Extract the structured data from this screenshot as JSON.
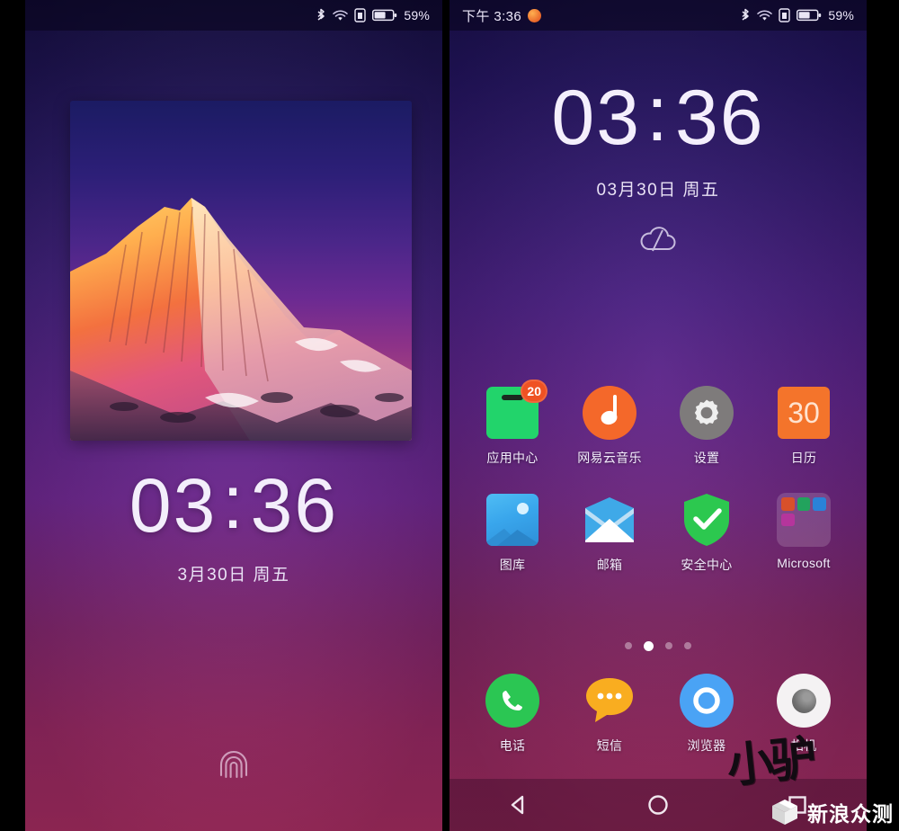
{
  "screens": {
    "lock": {
      "name": "lock-screen",
      "statusbar": {
        "time": "",
        "battery_percent": "59%",
        "icons": [
          "bluetooth-icon",
          "wifi-icon",
          "sim-icon",
          "battery-icon"
        ]
      },
      "clock": {
        "hours": "03",
        "separator": ":",
        "minutes": "36",
        "date": "3月30日  周五"
      },
      "unlock_hint_icon": "fingerprint-icon"
    },
    "home": {
      "name": "home-screen",
      "statusbar": {
        "time": "下午 3:36",
        "notification_icon": "orange-dot-icon",
        "battery_percent": "59%",
        "icons": [
          "bluetooth-icon",
          "wifi-icon",
          "sim-icon",
          "battery-icon"
        ]
      },
      "widget": {
        "hours": "03",
        "separator": ":",
        "minutes": "36",
        "date": "03月30日   周五",
        "weather_icon": "cloud-icon"
      },
      "apps": [
        {
          "label": "应用中心",
          "icon": "app-center-icon",
          "badge": "20",
          "color": "#22d46b"
        },
        {
          "label": "网易云音乐",
          "icon": "netease-music-icon",
          "badge": "",
          "color": "#f4682a"
        },
        {
          "label": "设置",
          "icon": "settings-gear-icon",
          "badge": "",
          "color": "#7e7b7b"
        },
        {
          "label": "日历",
          "icon": "calendar-icon",
          "badge": "",
          "color": "#f4742b",
          "day": "30"
        },
        {
          "label": "图库",
          "icon": "gallery-icon",
          "badge": "",
          "color": "#39a6ec"
        },
        {
          "label": "邮箱",
          "icon": "mail-icon",
          "badge": "",
          "color": "#2a9fe0"
        },
        {
          "label": "安全中心",
          "icon": "security-shield-icon",
          "badge": "",
          "color": "#2bc653"
        },
        {
          "label": "Microsoft",
          "icon": "folder-icon",
          "badge": "",
          "color": "#ffffff29"
        }
      ],
      "folder_mini_icons": [
        "powerpoint-icon",
        "excel-icon",
        "skype-icon",
        "onenote-icon"
      ],
      "page_indicator": {
        "total": 4,
        "active_index": 1
      },
      "dock": [
        {
          "label": "电话",
          "icon": "phone-icon",
          "color": "#2bc653"
        },
        {
          "label": "短信",
          "icon": "sms-bubble-icon",
          "color": "#f9ad20"
        },
        {
          "label": "浏览器",
          "icon": "browser-icon",
          "color": "#4aa3f5"
        },
        {
          "label": "相机",
          "icon": "camera-icon",
          "color": "#f4f2f3"
        }
      ],
      "navbar": [
        {
          "name": "back-button",
          "icon": "back-triangle-icon"
        },
        {
          "name": "home-button",
          "icon": "home-circle-icon"
        },
        {
          "name": "recents-button",
          "icon": "recents-square-icon"
        }
      ]
    }
  },
  "watermark": {
    "brush": "小驴",
    "text": "新浪众测",
    "logo_icon": "sina-cube-icon"
  },
  "colors": {
    "accent_orange": "#f4682a",
    "badge_red": "#ef5223",
    "green": "#22d46b",
    "blue": "#4aa3f5"
  }
}
